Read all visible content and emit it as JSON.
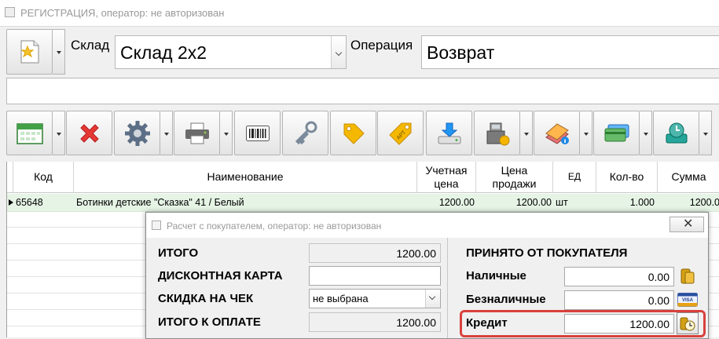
{
  "window": {
    "title": "РЕГИСТРАЦИЯ, оператор: не авторизован"
  },
  "header": {
    "sklad_label": "Склад",
    "sklad_value": "Склад 2x2",
    "operation_label": "Операция",
    "operation_value": "Возврат",
    "comment_value": ""
  },
  "toolbar": {
    "icons": [
      "calendar-icon",
      "delete-icon",
      "gear-icon",
      "printer-icon",
      "barcode-icon",
      "key-icon",
      "tag-icon",
      "price-tag-icon",
      "download-icon",
      "cash-register-icon",
      "books-icon",
      "card-icon",
      "disk-icon"
    ],
    "colors": {
      "accent_red": "#d9413d",
      "selected_row": "#e6f4e6"
    }
  },
  "table": {
    "columns": [
      "Код",
      "Наименование",
      "Учетная\nцена",
      "Цена\nпродажи",
      "ЕД",
      "Кол-во",
      "Сумма"
    ],
    "rows": [
      {
        "code": "65648",
        "name": "Ботинки детские \"Сказка\" 41 / Белый",
        "uchet": "1200.00",
        "price": "1200.00",
        "unit": "шт",
        "qty": "1.000",
        "sum": "1200.0"
      }
    ]
  },
  "dialog": {
    "title": "Расчет с покупателем, оператор: не авторизован",
    "close_label": "✕",
    "left": {
      "itogo_label": "ИТОГО",
      "itogo_value": "1200.00",
      "discount_card_label": "ДИСКОНТНАЯ КАРТА",
      "discount_card_value": "",
      "check_discount_label": "СКИДКА НА ЧЕК",
      "check_discount_value": "не выбрана",
      "to_pay_label": "ИТОГО К ОПЛАТЕ",
      "to_pay_value": "1200.00"
    },
    "right": {
      "heading": "ПРИНЯТО ОТ ПОКУПАТЕЛЯ",
      "cash_label": "Наличные",
      "cash_value": "0.00",
      "noncash_label": "Безналичные",
      "noncash_value": "0.00",
      "credit_label": "Кредит",
      "credit_value": "1200.00"
    }
  }
}
